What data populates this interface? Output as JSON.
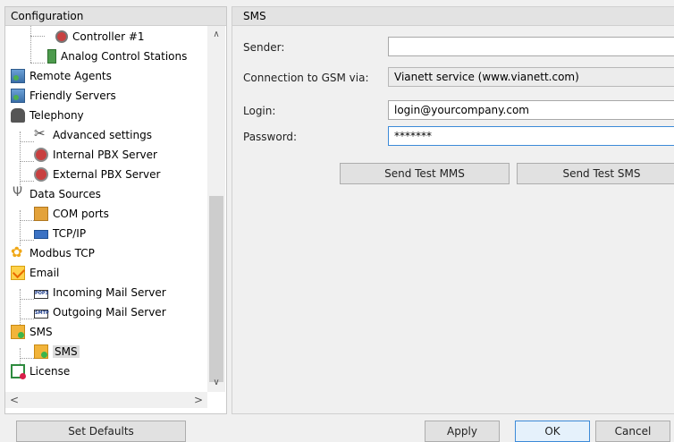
{
  "left": {
    "header": "Configuration",
    "tree": [
      {
        "label": "Controller #1",
        "icon": "controller-icon"
      },
      {
        "label": "Analog Control Stations",
        "icon": "analog-station-icon"
      },
      {
        "label": "Remote Agents",
        "icon": "remote-agents-icon"
      },
      {
        "label": "Friendly Servers",
        "icon": "friendly-servers-icon"
      },
      {
        "label": "Telephony",
        "icon": "telephone-icon"
      },
      {
        "label": "Advanced settings",
        "icon": "tools-icon"
      },
      {
        "label": "Internal PBX Server",
        "icon": "pbx-icon"
      },
      {
        "label": "External PBX Server",
        "icon": "pbx-icon"
      },
      {
        "label": "Data Sources",
        "icon": "usb-icon"
      },
      {
        "label": "COM ports",
        "icon": "com-port-icon"
      },
      {
        "label": "TCP/IP",
        "icon": "network-icon"
      },
      {
        "label": "Modbus TCP",
        "icon": "modbus-icon"
      },
      {
        "label": "Email",
        "icon": "email-icon"
      },
      {
        "label": "Incoming Mail Server",
        "icon": "pop3-icon"
      },
      {
        "label": "Outgoing Mail Server",
        "icon": "smtp-icon"
      },
      {
        "label": "SMS",
        "icon": "sms-icon"
      },
      {
        "label": "SMS",
        "icon": "sms-icon"
      },
      {
        "label": "License",
        "icon": "license-icon"
      }
    ],
    "scroll_up": "∧",
    "scroll_down": "∨",
    "scroll_left": "<",
    "scroll_right": ">"
  },
  "right": {
    "header": "SMS",
    "sender_label": "Sender:",
    "sender_value": "",
    "connection_label": "Connection to GSM via:",
    "connection_value": "Vianett service (www.vianett.com)",
    "login_label": "Login:",
    "login_value": "login@yourcompany.com",
    "password_label": "Password:",
    "password_value": "*******",
    "send_mms_label": "Send Test MMS",
    "send_sms_label": "Send Test SMS"
  },
  "footer": {
    "set_defaults_label": "Set Defaults",
    "apply_label": "Apply",
    "ok_label": "OK",
    "cancel_label": "Cancel"
  },
  "colors": {
    "focus_border": "#3c8ad8",
    "selected_bg": "#dcdcdc"
  }
}
